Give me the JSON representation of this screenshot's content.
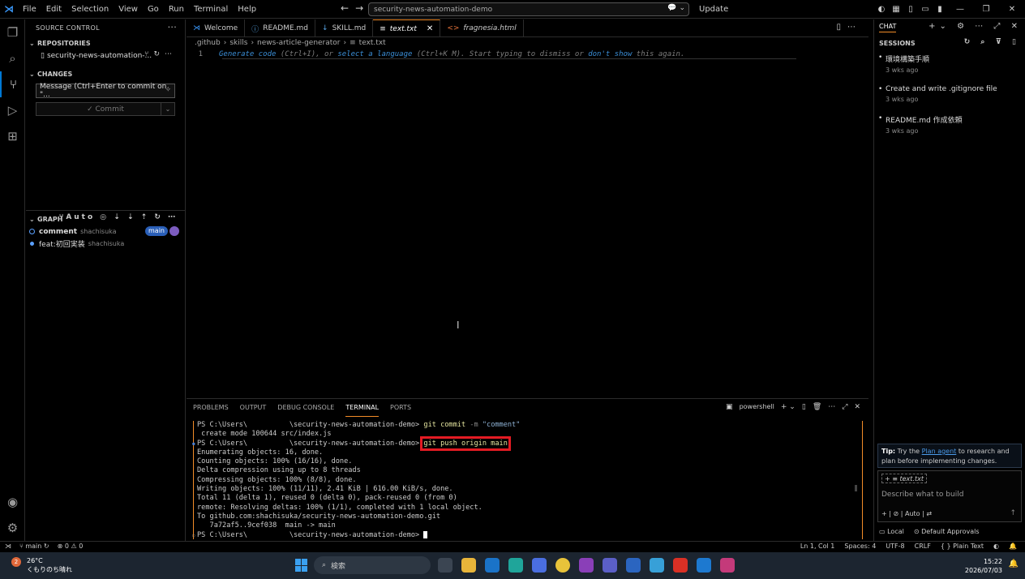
{
  "titlebar": {
    "menu": [
      "File",
      "Edit",
      "Selection",
      "View",
      "Go",
      "Run",
      "Terminal",
      "Help"
    ],
    "search_text": "security-news-automation-demo",
    "update_label": "Update"
  },
  "sidebar": {
    "header": "SOURCE CONTROL",
    "repositories_label": "REPOSITORIES",
    "repo_name": "security-news-automation-...",
    "changes_label": "CHANGES",
    "commit_placeholder": "Message (Ctrl+Enter to commit on \"...",
    "commit_button": "✓ Commit",
    "graph_label": "GRAPH",
    "graph_auto": "Auto",
    "graph_rows": [
      {
        "message": "comment",
        "author": "shachisuka",
        "badge": "main"
      },
      {
        "message": "feat:初回実装",
        "author": "shachisuka"
      }
    ]
  },
  "editor": {
    "tabs": [
      {
        "label": "Welcome",
        "icon": "vscode-icon"
      },
      {
        "label": "README.md",
        "icon": "info-icon"
      },
      {
        "label": "SKILL.md",
        "icon": "markdown-icon"
      },
      {
        "label": "text.txt",
        "icon": "file-icon",
        "active": true
      },
      {
        "label": "fragnesia.html",
        "icon": "html-icon"
      }
    ],
    "breadcrumb": [
      ".github",
      "skills",
      "news-article-generator",
      "text.txt"
    ],
    "line_number": "1",
    "hint": {
      "link1": "Generate code",
      "t1": " (Ctrl+I), or ",
      "link2": "select a language",
      "t2": " (Ctrl+K M). Start typing to dismiss or ",
      "link3": "don't show",
      "t3": " this again."
    }
  },
  "panel": {
    "tabs": [
      "PROBLEMS",
      "OUTPUT",
      "DEBUG CONSOLE",
      "TERMINAL",
      "PORTS"
    ],
    "active_tab": "TERMINAL",
    "shell": "powershell",
    "terminal": {
      "l1_prompt": "PS C:\\Users\\          \\security-news-automation-demo> ",
      "l1_cmd": "git commit",
      "l1_flag": " -m ",
      "l1_str": "\"comment\"",
      "l2": " create mode 100644 src/index.js",
      "l3_prompt": "PS C:\\Users\\          \\security-news-automation-demo> ",
      "l3_cmd": "git push origin main",
      "l4": "Enumerating objects: 16, done.",
      "l5": "Counting objects: 100% (16/16), done.",
      "l6": "Delta compression using up to 8 threads",
      "l7": "Compressing objects: 100% (8/8), done.",
      "l8": "Writing objects: 100% (11/11), 2.41 KiB | 616.00 KiB/s, done.",
      "l9": "Total 11 (delta 1), reused 0 (delta 0), pack-reused 0 (from 0)",
      "l10": "remote: Resolving deltas: 100% (1/1), completed with 1 local object.",
      "l11": "To github.com:shachisuka/security-news-automation-demo.git",
      "l12": "   7a72af5..9cef038  main -> main",
      "l13_prompt": "PS C:\\Users\\          \\security-news-automation-demo> "
    }
  },
  "chat": {
    "title": "CHAT",
    "sessions_label": "SESSIONS",
    "sessions": [
      {
        "title": "環境構築手順",
        "age": "3 wks ago"
      },
      {
        "title": "Create and write .gitignore file",
        "age": "3 wks ago"
      },
      {
        "title": "README.md 作成依頼",
        "age": "3 wks ago"
      }
    ],
    "tip_bold": "Tip:",
    "tip_t1": " Try the ",
    "tip_link": "Plan agent",
    "tip_t2": " to research and plan before implementing changes.",
    "attachment": "text.txt",
    "placeholder": "Describe what to build",
    "mode": "Auto",
    "footer_local": "Local",
    "footer_approvals": "Default Approvals"
  },
  "status": {
    "branch": "main",
    "problems": "⊗ 0 ⚠ 0",
    "position": "Ln 1, Col 1",
    "spaces": "Spaces: 4",
    "encoding": "UTF-8",
    "eol": "CRLF",
    "language": "{ } Plain Text"
  },
  "taskbar": {
    "temp": "26°C",
    "weather": "くもりのち晴れ",
    "search": "検索",
    "time": "15:22",
    "date": "2026/07/03",
    "weather_badge": "2"
  }
}
